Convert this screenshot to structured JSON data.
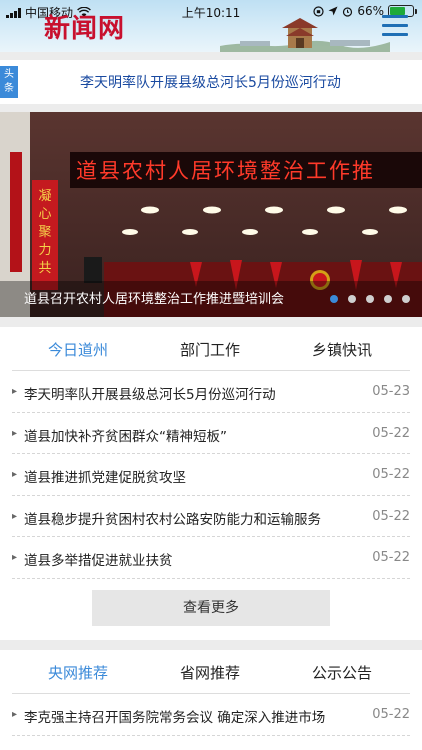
{
  "status_bar": {
    "carrier": "中国移动",
    "time": "上午10:11",
    "battery": "66%",
    "battery_level": 0.66
  },
  "header": {
    "logo": "新闻网",
    "accent_color": "#3b8ad9",
    "logo_color": "#c8102e"
  },
  "headline": {
    "tag": "头条",
    "text": "李天明率队开展县级总河长5月份巡河行动"
  },
  "banner": {
    "screen_text": "道县农村人居环境整治工作推",
    "caption": "道县召开农村人居环境整治工作推进暨培训会",
    "slide_count": 5,
    "active_slide": 1
  },
  "news_section": {
    "tabs": [
      {
        "label": "今日道州",
        "active": true
      },
      {
        "label": "部门工作",
        "active": false
      },
      {
        "label": "乡镇快讯",
        "active": false
      }
    ],
    "items": [
      {
        "title": "李天明率队开展县级总河长5月份巡河行动",
        "date": "05-23"
      },
      {
        "title": "道县加快补齐贫困群众“精神短板”",
        "date": "05-22"
      },
      {
        "title": "道县推进抓党建促脱贫攻坚",
        "date": "05-22"
      },
      {
        "title": "道县稳步提升贫困村农村公路安防能力和运输服务",
        "date": "05-22"
      },
      {
        "title": "道县多举措促进就业扶贫",
        "date": "05-22"
      }
    ],
    "more_label": "查看更多"
  },
  "recommend_section": {
    "tabs": [
      {
        "label": "央网推荐",
        "active": true
      },
      {
        "label": "省网推荐",
        "active": false
      },
      {
        "label": "公示公告",
        "active": false
      }
    ],
    "items": [
      {
        "title": "李克强主持召开国务院常务会议 确定深入推进市场",
        "date": "05-22"
      }
    ]
  }
}
